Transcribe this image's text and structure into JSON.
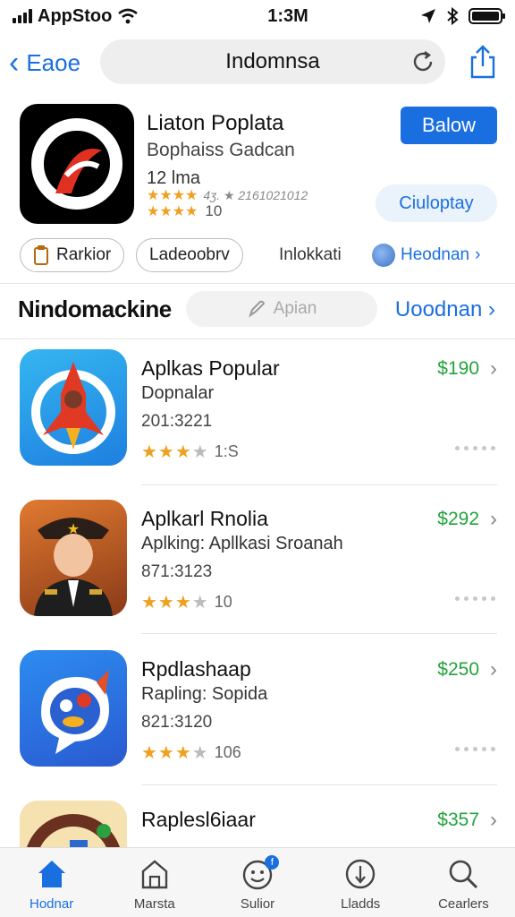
{
  "status_bar": {
    "carrier": "AppStoo",
    "time": "1:3M"
  },
  "nav": {
    "back_label": "Eaoe",
    "search_text": "Indomnsa"
  },
  "featured": {
    "title": "Liaton Poplata",
    "subtitle": "Bophaiss Gadcan",
    "meta": "12 lma",
    "rating_text_1": "4ʒ. ★ 2161021012",
    "rating_text_2": "10",
    "get_label": "Balow",
    "secondary_label": "Ciuloptay",
    "chips": [
      "Rarkior",
      "Ladeoobrv"
    ],
    "plain_chip": "Inlokkati",
    "link_chip": "Heodnan"
  },
  "section": {
    "title": "Nindomackine",
    "search_placeholder": "Apian",
    "link": "Uoodnan"
  },
  "apps": [
    {
      "name": "Aplkas Popular",
      "subtitle": "Dopnalar",
      "date": "201:3221",
      "rating_count": "1:S",
      "stars": 3,
      "price": "$190"
    },
    {
      "name": "Aplkarl Rnolia",
      "subtitle": "Aplking: Apllkasi Sroanah",
      "date": "871:3123",
      "rating_count": "10",
      "stars": 3,
      "price": "$292"
    },
    {
      "name": "Rpdlashaap",
      "subtitle": "Rapling: Sopida",
      "date": "821:3120",
      "rating_count": "106",
      "stars": 3,
      "price": "$250"
    },
    {
      "name": "Raplesl6iaar",
      "subtitle": "",
      "date": "",
      "rating_count": "",
      "stars": 0,
      "price": "$357"
    }
  ],
  "tabs": [
    "Hodnar",
    "Marsta",
    "Sulior",
    "Lladds",
    "Cearlers"
  ],
  "colors": {
    "accent": "#1a6fe0",
    "price_green": "#22a33c",
    "star": "#f0a020"
  }
}
